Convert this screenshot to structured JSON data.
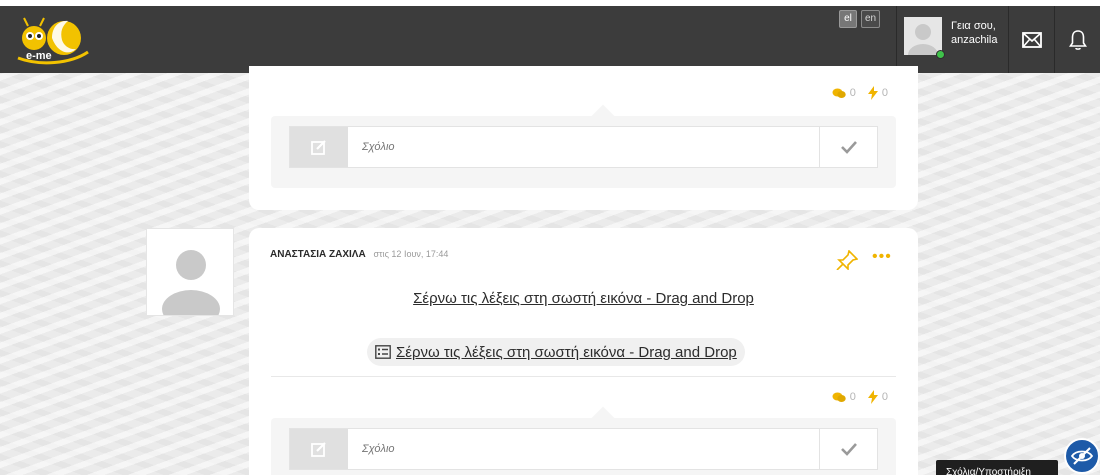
{
  "header": {
    "logo_text": "e-me",
    "languages": [
      {
        "code": "el",
        "active": true
      },
      {
        "code": "en",
        "active": false
      }
    ],
    "user": {
      "greeting": "Γεια σου,",
      "username": "anzachila",
      "status_color": "#3fc24a"
    },
    "icons": [
      "envelope-icon",
      "bell-icon"
    ]
  },
  "posts": [
    {
      "counts": {
        "comments": "0",
        "likes": "0"
      },
      "comment": {
        "placeholder": "Σχόλιο"
      }
    },
    {
      "author": "ΑΝΑΣΤΑΣΙΑ ΖΑΧΙΛΑ",
      "date": "στις 12 Ιουν, 17:44",
      "title": "Σέρνω τις λέξεις στη σωστή εικόνα - Drag and Drop",
      "link_label": "Σέρνω τις λέξεις στη σωστή εικόνα - Drag and Drop",
      "counts": {
        "comments": "0",
        "likes": "0"
      },
      "comment": {
        "placeholder": "Σχόλιο"
      }
    }
  ],
  "footer": {
    "tooltip": "Σχόλια/Υποστήριξη"
  },
  "colors": {
    "topbar": "#3c3c3c",
    "accent": "#f0b400",
    "help_button": "#1d5aa8"
  }
}
